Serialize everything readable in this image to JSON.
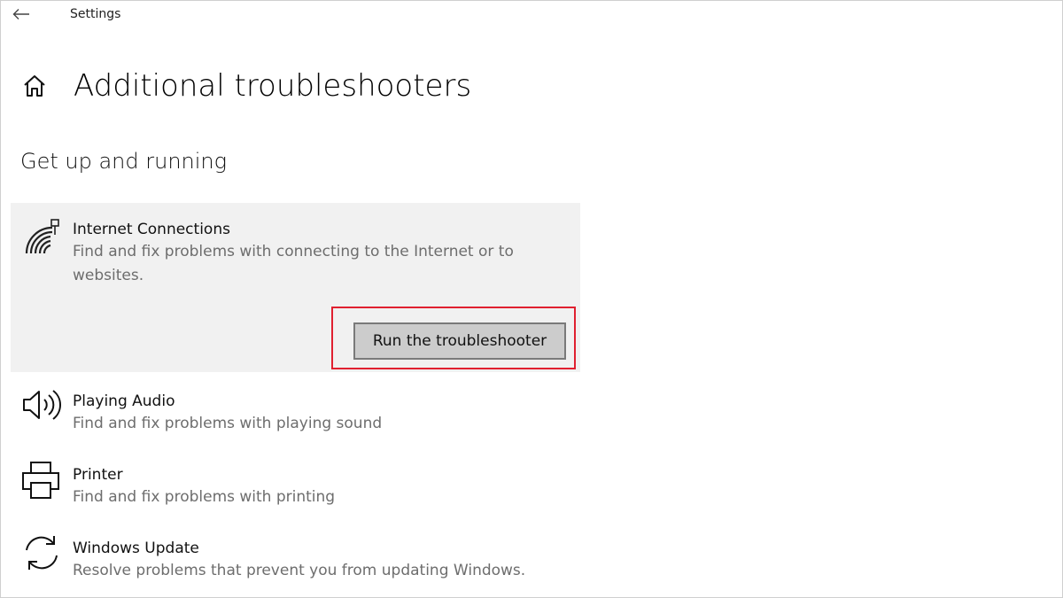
{
  "window": {
    "app_title": "Settings"
  },
  "page": {
    "title": "Additional troubleshooters"
  },
  "section": {
    "title": "Get up and running"
  },
  "items": [
    {
      "icon": "wifi-network-icon",
      "title": "Internet Connections",
      "description": "Find and fix problems with connecting to the Internet or to websites.",
      "selected": true,
      "action_label": "Run the troubleshooter"
    },
    {
      "icon": "speaker-icon",
      "title": "Playing Audio",
      "description": "Find and fix problems with playing sound"
    },
    {
      "icon": "printer-icon",
      "title": "Printer",
      "description": "Find and fix problems with printing"
    },
    {
      "icon": "sync-icon",
      "title": "Windows Update",
      "description": "Resolve problems that prevent you from updating Windows."
    }
  ],
  "colors": {
    "selected_background": "#f1f1f1",
    "highlight": "#e02030",
    "button_background": "#cccccc"
  }
}
